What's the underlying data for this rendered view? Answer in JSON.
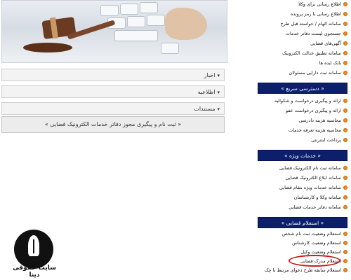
{
  "panels": [
    {
      "label": "اخبار",
      "chevron": "chevron-down-icon"
    },
    {
      "label": "اطلاعیه",
      "chevron": "chevron-down-icon"
    },
    {
      "label": "مستندات",
      "chevron": "chevron-down-icon"
    }
  ],
  "register_link": "«  ثبت نام و پیگیری مجوز دفاتر خدمات الکترونیک قضایی  »",
  "sidebar": {
    "top_items": [
      "اطلاع رسانی برای وکلا",
      "اطلاع رسانی با رمز پرونده",
      "سامانه الهام / خواسته قبل طرح",
      "جستجوی لیست دفاتر خدمات",
      "آگهی‌های قضایی",
      "سامانه تطبیق عدالت الکترونیک",
      "بانک ایده ها",
      "سامانه ثبت دارایی مسئولان"
    ],
    "quick_access": {
      "title": "« دسترسی سریع »",
      "items": [
        "ارائه و پیگیری درخواست و شکوائیه",
        "ارائه و پیگیری درخواست عفو",
        "محاسبه هزینه دادرسی",
        "محاسبه هزینه تعرفه خدمات",
        "پرداخت اینترنتی"
      ]
    },
    "special_services": {
      "title": "« خدمات ویژه »",
      "items": [
        "سامانه ثبت نام الکترونیک قضایی",
        "سامانه ابلاغ الکترونیک قضایی",
        "سامانه خدمات ویژه مقام قضایی",
        "سامانه وکلا و کارشناسان",
        "سامانه دفاتر خدمات قضایی"
      ]
    },
    "judicial_inquiry": {
      "title": "« استعلام قضایی »",
      "items": [
        "استعلام وضعیت ثبت نام شخص",
        "استعلام وضعیت کارشناس",
        "استعلام وضعیت وکیل",
        "استعلام مدرک قضایی",
        "استعلام سابقه طرح دعوای مرتبط با چک"
      ]
    }
  },
  "logo": {
    "text": "سایت حقوقی دینا"
  },
  "colors": {
    "sidebar_header": "#0c1f6b",
    "bullet": "#f08a1c",
    "highlight": "#d01818"
  }
}
